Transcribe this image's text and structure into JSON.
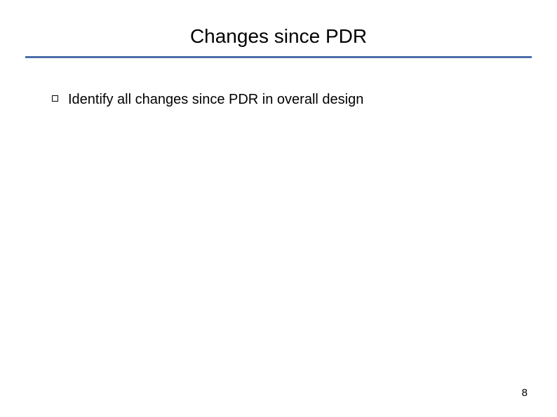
{
  "slide": {
    "title": "Changes since PDR",
    "bullets": [
      {
        "text": "Identify all changes since PDR in overall design"
      }
    ],
    "page_number": "8"
  }
}
